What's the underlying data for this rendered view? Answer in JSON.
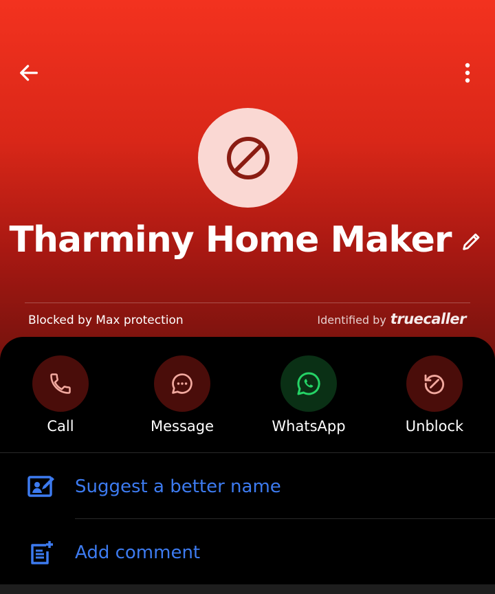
{
  "header": {
    "contact_name": "Tharminy Home Maker",
    "blocked_status": "Blocked by Max protection",
    "identified_label": "Identified by",
    "brand": "truecaller",
    "gradient_top": "#f3321f",
    "gradient_bottom": "#6f120d"
  },
  "icons": {
    "back": "arrow-left-icon",
    "more": "more-vertical-icon",
    "avatar": "block-icon",
    "edit": "pencil-icon"
  },
  "actions": [
    {
      "label": "Call",
      "icon": "phone-icon",
      "bg": "#4a0d0a",
      "fg": "#f2a99f"
    },
    {
      "label": "Message",
      "icon": "chat-bubble-icon",
      "bg": "#4a0d0a",
      "fg": "#f2a99f"
    },
    {
      "label": "WhatsApp",
      "icon": "whatsapp-icon",
      "bg": "#0a3015",
      "fg": "#25d366"
    },
    {
      "label": "Unblock",
      "icon": "unblock-icon",
      "bg": "#4a0d0a",
      "fg": "#f2a99f"
    }
  ],
  "rows": [
    {
      "label": "Suggest a better name",
      "icon": "edit-name-icon"
    },
    {
      "label": "Add comment",
      "icon": "add-comment-icon"
    }
  ],
  "colors": {
    "link_blue": "#3d7bf0",
    "avatar_bg": "#fad8d3",
    "block_red": "#8a1c12"
  }
}
